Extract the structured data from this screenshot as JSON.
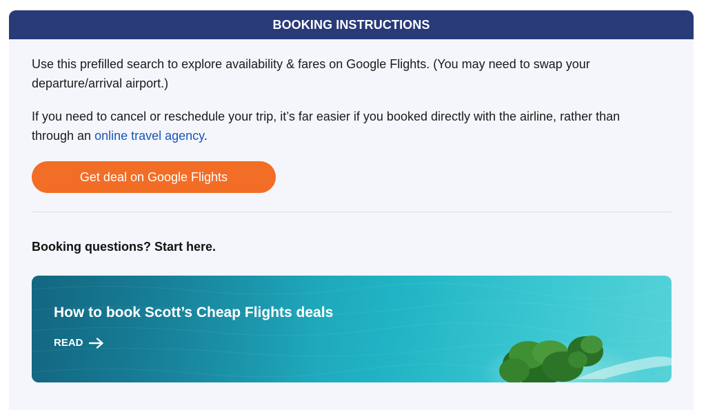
{
  "header": {
    "title": "BOOKING INSTRUCTIONS"
  },
  "intro": {
    "paragraph1": "Use this prefilled search to explore availability & fares on Google Flights. (You may need to swap your departure/arrival airport.)",
    "paragraph2_before": "If you need to cancel or reschedule your trip, it’s far easier if you booked directly with the airline, rather than through an ",
    "paragraph2_link": "online travel agency",
    "paragraph2_after": "."
  },
  "cta": {
    "label": "Get deal on Google Flights"
  },
  "questions": {
    "heading": "Booking questions? Start here."
  },
  "article": {
    "title": "How to book Scott’s Cheap Flights deals",
    "read_label": "READ",
    "arrow_icon": "arrow-right-icon"
  },
  "colors": {
    "header_bg": "#283a78",
    "panel_bg": "#f4f6fb",
    "cta_bg": "#f26d26",
    "link": "#1a55b5"
  }
}
